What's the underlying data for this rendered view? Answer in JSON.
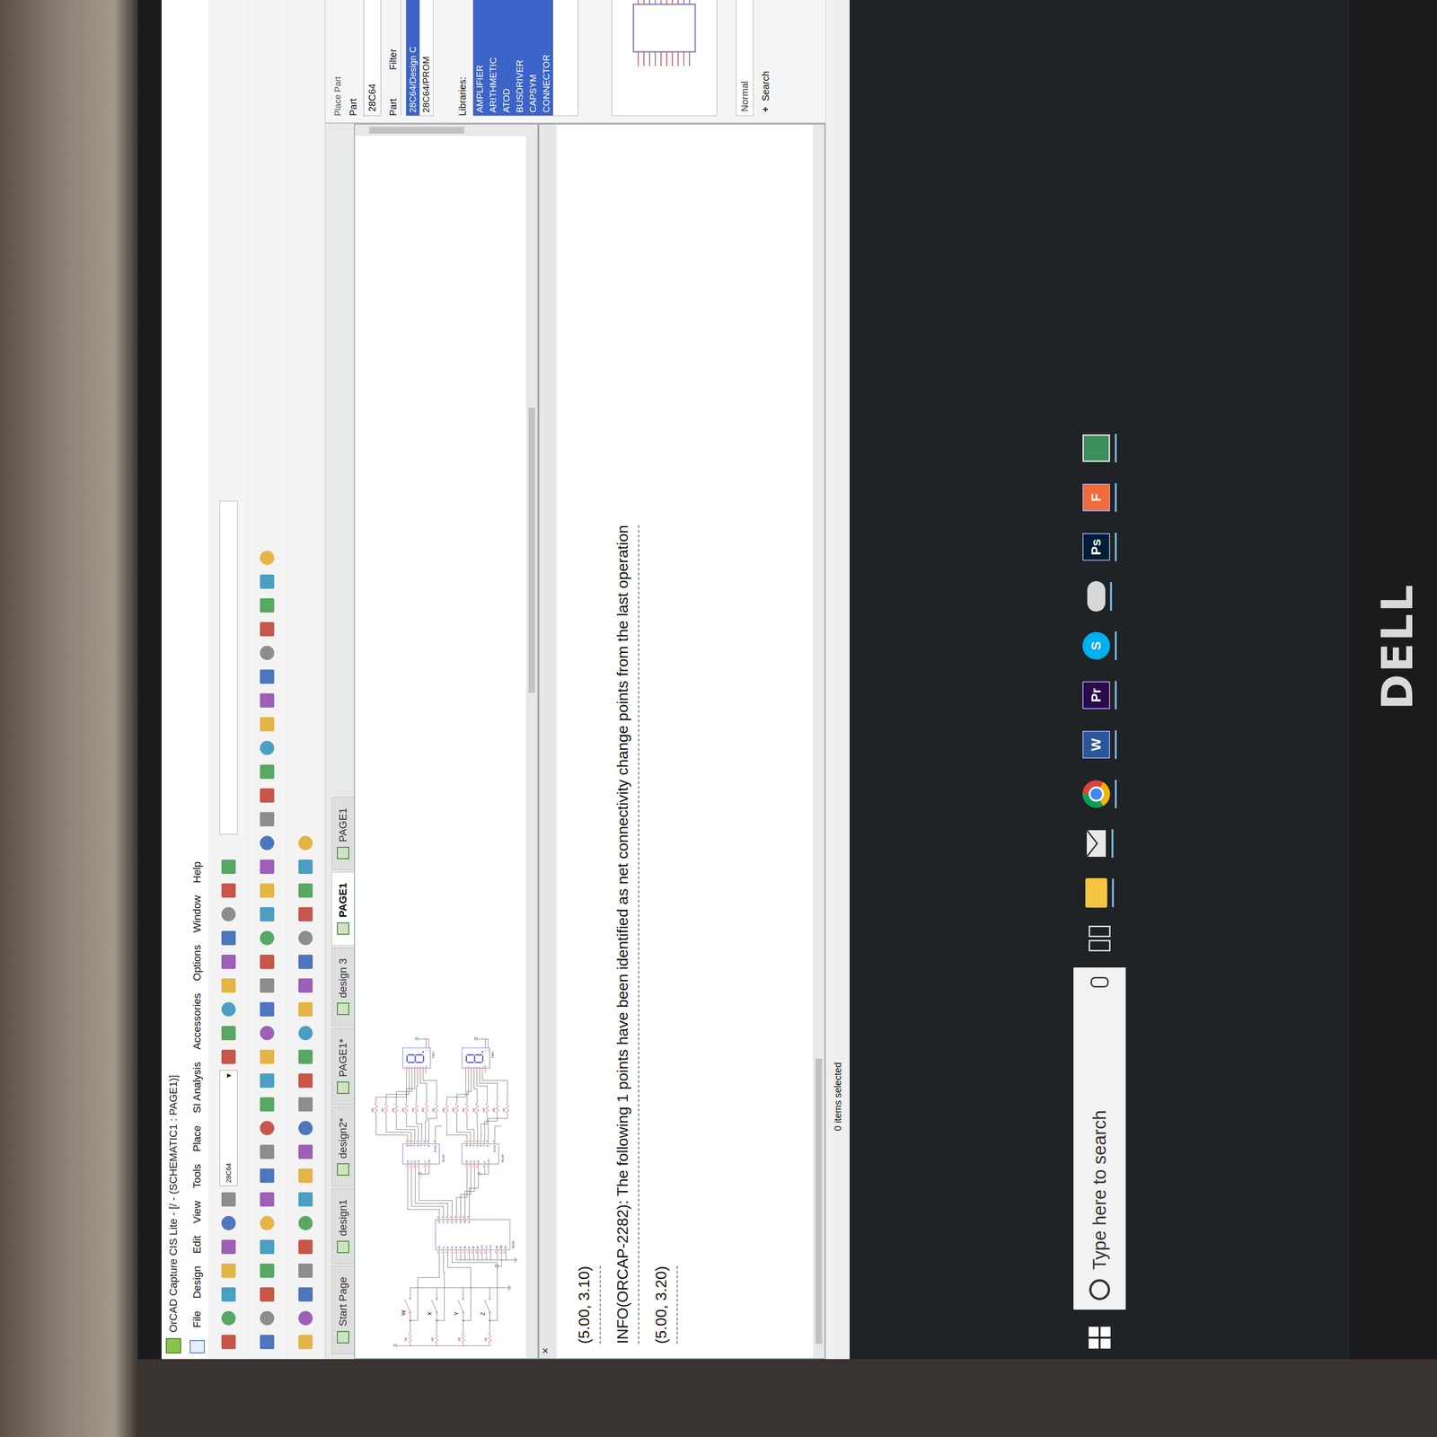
{
  "window": {
    "title": "OrCAD Capture CIS Lite - [/ - (SCHEMATIC1 : PAGE1)]"
  },
  "menu": [
    "File",
    "Design",
    "Edit",
    "View",
    "Tools",
    "Place",
    "SI Analysis",
    "Accessories",
    "Options",
    "Window",
    "Help"
  ],
  "toolbar": {
    "part_search": "28C64"
  },
  "tabs": [
    {
      "label": "Start Page",
      "selected": false
    },
    {
      "label": "design1",
      "selected": false
    },
    {
      "label": "design2*",
      "selected": false
    },
    {
      "label": "PAGE1*",
      "selected": false
    },
    {
      "label": "design 3",
      "selected": false
    },
    {
      "label": "PAGE1",
      "selected": true
    },
    {
      "label": "PAGE1",
      "selected": false
    }
  ],
  "schematic": {
    "supply": "5V",
    "switches": [
      {
        "label": "W",
        "resistor": "330",
        "closed": false
      },
      {
        "label": "X",
        "resistor": "330",
        "closed": false
      },
      {
        "label": "Y",
        "resistor": "330",
        "closed": false
      },
      {
        "label": "Z",
        "resistor": "330",
        "closed": false
      }
    ],
    "eeprom": {
      "name": "28C64",
      "address_pins": [
        {
          "name": "A0",
          "number": "10"
        },
        {
          "name": "A1",
          "number": "9"
        },
        {
          "name": "A2",
          "number": "8"
        },
        {
          "name": "A3",
          "number": "7"
        },
        {
          "name": "A4",
          "number": "6"
        },
        {
          "name": "A5",
          "number": "5"
        },
        {
          "name": "A6",
          "number": "4"
        },
        {
          "name": "A7",
          "number": "3"
        },
        {
          "name": "A8",
          "number": "25"
        },
        {
          "name": "A9",
          "number": "24"
        },
        {
          "name": "A10",
          "number": "21"
        },
        {
          "name": "A11",
          "number": "23"
        },
        {
          "name": "A12",
          "number": "2"
        }
      ],
      "control_pins": [
        {
          "name": "OE",
          "number": "22"
        },
        {
          "name": "WE",
          "number": "27"
        },
        {
          "name": "CE",
          "number": "20"
        }
      ],
      "data_pins": [
        {
          "name": "D0",
          "number": "11"
        },
        {
          "name": "D1",
          "number": "12"
        },
        {
          "name": "D2",
          "number": "13"
        },
        {
          "name": "D3",
          "number": "15"
        },
        {
          "name": "D4",
          "number": "16"
        },
        {
          "name": "D5",
          "number": "17"
        },
        {
          "name": "D6",
          "number": "18"
        },
        {
          "name": "D7",
          "number": "19"
        }
      ]
    },
    "decoders": [
      {
        "name": "74LS47",
        "inputs": [
          {
            "name": "D0",
            "number": "7"
          },
          {
            "name": "D1",
            "number": "1"
          },
          {
            "name": "D2",
            "number": "2"
          },
          {
            "name": "D3",
            "number": "6"
          }
        ],
        "controls": [
          {
            "name": "LT",
            "number": "3"
          },
          {
            "name": "RBI",
            "number": "5"
          }
        ],
        "outputs": [
          {
            "name": "A",
            "number": "13"
          },
          {
            "name": "B",
            "number": "12"
          },
          {
            "name": "C",
            "number": "11"
          },
          {
            "name": "D",
            "number": "10"
          },
          {
            "name": "E",
            "number": "9"
          },
          {
            "name": "F",
            "number": "15"
          },
          {
            "name": "G",
            "number": "14"
          }
        ],
        "blank": {
          "name": "BI/RBO",
          "number": "4"
        }
      },
      {
        "name": "74LS47",
        "inputs": [
          {
            "name": "D0",
            "number": "7"
          },
          {
            "name": "D1",
            "number": "1"
          },
          {
            "name": "D2",
            "number": "2"
          },
          {
            "name": "D3",
            "number": "6"
          }
        ],
        "controls": [
          {
            "name": "LT",
            "number": "3"
          },
          {
            "name": "RBI",
            "number": "5"
          }
        ],
        "outputs": [
          {
            "name": "A",
            "number": "13"
          },
          {
            "name": "B",
            "number": "12"
          },
          {
            "name": "C",
            "number": "11"
          },
          {
            "name": "D",
            "number": "10"
          },
          {
            "name": "E",
            "number": "9"
          },
          {
            "name": "F",
            "number": "15"
          },
          {
            "name": "G",
            "number": "14"
          }
        ],
        "blank": {
          "name": "BI/RBO",
          "number": "4"
        }
      }
    ],
    "resistors": [
      "330",
      "330",
      "330",
      "330",
      "330",
      "330",
      "330",
      "330",
      "330",
      "330",
      "330",
      "330",
      "330",
      "330"
    ],
    "displays": [
      {
        "name": "FND1",
        "pins": [
          "a",
          "b",
          "c",
          "d",
          "e",
          "f",
          "g",
          "dp"
        ],
        "common": "cc"
      },
      {
        "name": "FND2",
        "pins": [
          "a",
          "b",
          "c",
          "d",
          "e",
          "f",
          "g",
          "dp"
        ],
        "common": "cc"
      }
    ]
  },
  "place_part": {
    "title": "Place Part",
    "part_label": "Part",
    "part_value": "28C64",
    "list_header": "Part",
    "filter_header": "Filter",
    "parts": [
      {
        "label": "28C64/Design C",
        "selected": true
      },
      {
        "label": "28C64/PROM",
        "selected": false
      }
    ],
    "libraries_label": "Libraries:",
    "libraries": [
      {
        "label": "AMPLIFIER",
        "selected": true
      },
      {
        "label": "ARITHMETIC",
        "selected": true
      },
      {
        "label": "ATOD",
        "selected": true
      },
      {
        "label": "BUSDRIVER",
        "selected": true
      },
      {
        "label": "CAPSYM",
        "selected": true
      },
      {
        "label": "CONNECTOR",
        "selected": true
      }
    ],
    "mode": "Normal",
    "search": "Search"
  },
  "session_log": [
    "(5.00, 3.10)",
    "INFO(ORCAP-2282): The following 1 points have been identified as net connectivity change points from the last operation",
    "(5.00, 3.20)"
  ],
  "status_bar": {
    "selection": "0 items selected"
  },
  "taskbar": {
    "search_placeholder": "Type here to search",
    "apps": [
      {
        "kind": "explorer",
        "label": "",
        "color": "#f4c542"
      },
      {
        "kind": "mail",
        "label": "",
        "color": "#e8e8e8"
      },
      {
        "kind": "chrome",
        "label": "",
        "color": "#db4437"
      },
      {
        "kind": "letter",
        "label": "W",
        "color": "#2b579a"
      },
      {
        "kind": "letter",
        "label": "Pr",
        "color": "#2a0a4a"
      },
      {
        "kind": "round",
        "label": "S",
        "color": "#00aff0"
      },
      {
        "kind": "cloud",
        "label": "",
        "color": "#d8d8d8"
      },
      {
        "kind": "letter",
        "label": "Ps",
        "color": "#001e36"
      },
      {
        "kind": "letter",
        "label": "F",
        "color": "#f26b3a"
      },
      {
        "kind": "photo",
        "label": "",
        "color": "#3b8f5a"
      }
    ]
  },
  "monitor": {
    "brand": "DELL"
  }
}
